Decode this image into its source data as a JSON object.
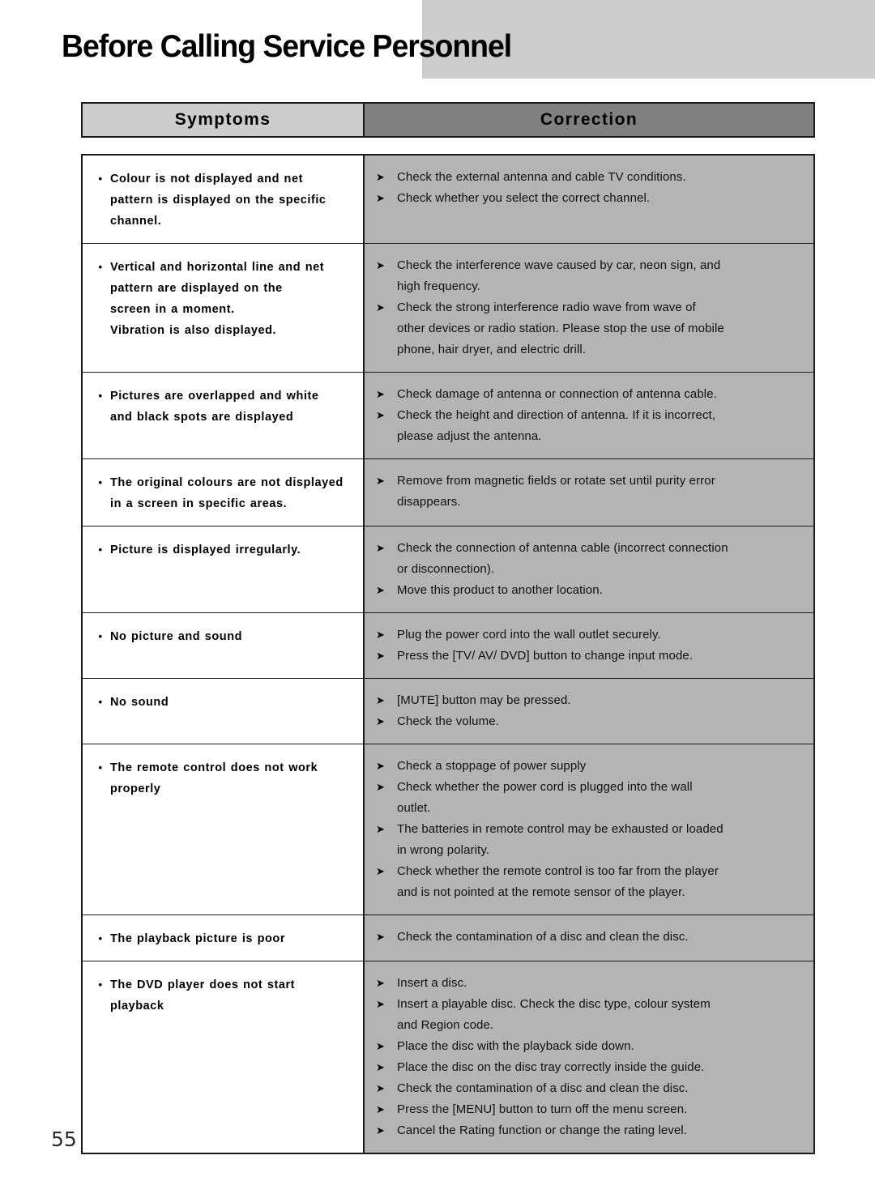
{
  "document": {
    "title": "Before Calling Service Personnel",
    "page_number": "55"
  },
  "colors": {
    "title_band": "#cccccc",
    "symptoms_header": "#cccccc",
    "correction_header": "#808080",
    "correction_cell": "#b4b4b4",
    "border": "#1a1a1a"
  },
  "table": {
    "headers": {
      "symptoms": "Symptoms",
      "correction": "Correction"
    },
    "bullet_glyph": "•",
    "arrow_glyph": "➤",
    "rows": [
      {
        "symptom_lines": [
          {
            "bullet": true,
            "text": "Colour is  not displayed and net"
          },
          {
            "bullet": false,
            "text": "pattern is displayed on the specific"
          },
          {
            "bullet": false,
            "text": "channel."
          }
        ],
        "corrections": [
          [
            "Check the external antenna and cable TV conditions."
          ],
          [
            "Check whether you select the correct channel."
          ]
        ]
      },
      {
        "symptom_lines": [
          {
            "bullet": true,
            "text": "Vertical and horizontal  line and net"
          },
          {
            "bullet": false,
            "text": "pattern  are  displayed on the"
          },
          {
            "bullet": false,
            "text": "screen in  a moment."
          },
          {
            "bullet": false,
            "text": "Vibration is also displayed."
          }
        ],
        "corrections": [
          [
            "Check the interference wave caused by car, neon sign, and",
            "high frequency."
          ],
          [
            "Check the strong interference radio wave from  wave of",
            "other devices or radio station. Please stop the use of mobile",
            "phone, hair dryer, and electric drill."
          ]
        ]
      },
      {
        "symptom_lines": [
          {
            "bullet": true,
            "text": "Pictures are overlapped and white"
          },
          {
            "bullet": false,
            "text": "and black spots are displayed"
          }
        ],
        "corrections": [
          [
            "Check damage of antenna or connection of antenna cable."
          ],
          [
            "Check the height and direction of antenna. If it is incorrect,",
            "please adjust the antenna."
          ]
        ]
      },
      {
        "symptom_lines": [
          {
            "bullet": true,
            "text": "The original colours are not displayed"
          },
          {
            "bullet": false,
            "text": "in a screen in specific areas."
          }
        ],
        "corrections": [
          [
            "Remove from magnetic fields or rotate set until purity error",
            "disappears."
          ]
        ]
      },
      {
        "symptom_lines": [
          {
            "bullet": true,
            "text": "Picture is displayed irregularly."
          }
        ],
        "corrections": [
          [
            "Check the connection of antenna cable (incorrect connection",
            "or disconnection)."
          ],
          [
            "Move this product to another location."
          ]
        ]
      },
      {
        "symptom_lines": [
          {
            "bullet": true,
            "text": "No picture and sound"
          }
        ],
        "corrections": [
          [
            "Plug the power cord into the wall outlet securely."
          ],
          [
            "Press the [TV/ AV/ DVD] button to change input mode."
          ]
        ]
      },
      {
        "symptom_lines": [
          {
            "bullet": true,
            "text": "No sound"
          }
        ],
        "corrections": [
          [
            "[MUTE] button may be pressed."
          ],
          [
            "Check the volume."
          ]
        ]
      },
      {
        "symptom_lines": [
          {
            "bullet": true,
            "text": "The remote control does not work"
          },
          {
            "bullet": false,
            "text": "properly"
          }
        ],
        "corrections": [
          [
            "Check a stoppage of power supply"
          ],
          [
            "Check whether the power cord is plugged into the wall",
            "outlet."
          ],
          [
            "The batteries in remote control may be exhausted or loaded",
            "in wrong polarity."
          ],
          [
            "Check whether the remote control is too far from the player",
            "and  is not  pointed at the remote  sensor of  the player."
          ]
        ]
      },
      {
        "symptom_lines": [
          {
            "bullet": true,
            "text": "The playback picture is poor"
          }
        ],
        "corrections": [
          [
            "Check the contamination of a disc and clean the disc."
          ]
        ]
      },
      {
        "symptom_lines": [
          {
            "bullet": true,
            "text": "The DVD player does not start"
          },
          {
            "bullet": false,
            "text": "playback"
          }
        ],
        "corrections": [
          [
            "Insert a disc."
          ],
          [
            "Insert a playable disc. Check the disc type, colour system",
            "and Region code."
          ],
          [
            "Place the disc with the playback side down."
          ],
          [
            "Place  the disc  on the  disc tray correctly inside the guide."
          ],
          [
            "Check the contamination of a disc and clean the disc."
          ],
          [
            "Press the [MENU] button to turn off the menu screen."
          ],
          [
            "Cancel the Rating  function or change the rating level."
          ]
        ]
      }
    ]
  }
}
